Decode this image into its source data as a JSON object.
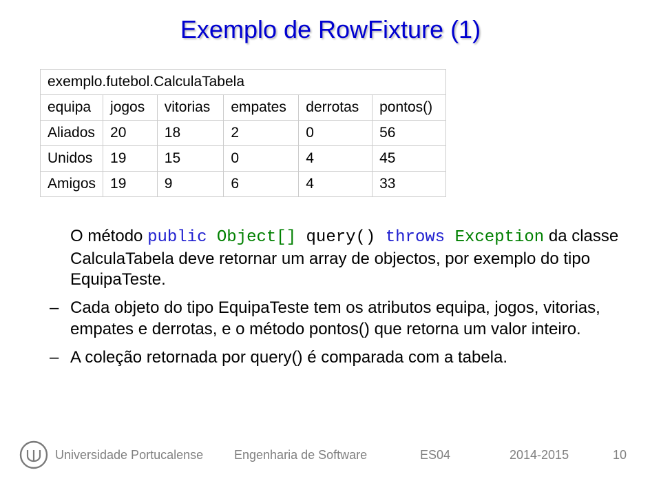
{
  "title": "Exemplo de RowFixture (1)",
  "table": {
    "caption": "exemplo.futebol.CalculaTabela",
    "headers": [
      "equipa",
      "jogos",
      "vitorias",
      "empates",
      "derrotas",
      "pontos()"
    ],
    "rows": [
      [
        "Aliados",
        "20",
        "18",
        "2",
        "0",
        "56"
      ],
      [
        "Unidos",
        "19",
        "15",
        "0",
        "4",
        "45"
      ],
      [
        "Amigos",
        "19",
        "9",
        "6",
        "4",
        "33"
      ]
    ]
  },
  "code": {
    "kw_public": "public",
    "kw_throws": "throws",
    "type_object_arr": "Object[]",
    "type_exception": "Exception",
    "method": " query() "
  },
  "bullets": {
    "b1_pre": "O método ",
    "b1_mid": " da classe CalculaTabela deve retornar um array de objectos, por exemplo do tipo EquipaTeste.",
    "b2": "Cada objeto do tipo EquipaTeste tem os atributos equipa, jogos, vitorias, empates e derrotas, e o método pontos() que retorna um valor inteiro.",
    "b3": "A coleção retornada por query() é comparada com a tabela."
  },
  "footer": {
    "universidade": "Universidade Portucalense",
    "curso": "Engenharia de Software",
    "codigo": "ES04",
    "ano": "2014-2015",
    "pagina": "10"
  },
  "icons": {
    "logo_label": "UPT"
  }
}
